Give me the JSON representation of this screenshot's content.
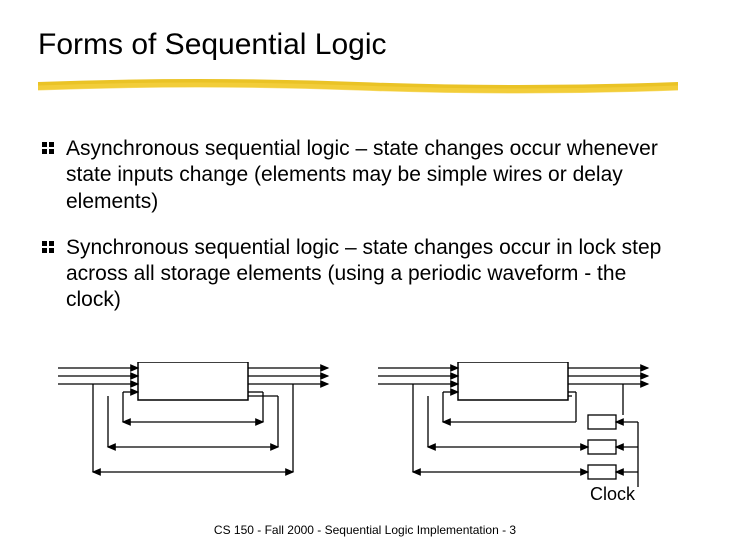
{
  "title": "Forms of Sequential Logic",
  "bullets": [
    "Asynchronous sequential logic – state changes occur whenever state inputs change (elements may be simple wires or delay elements)",
    "Synchronous sequential logic – state changes occur in lock step across all storage elements (using a periodic waveform - the clock)"
  ],
  "clock_label": "Clock",
  "footer": "CS 150 - Fall  2000 - Sequential Logic Implementation - 3"
}
